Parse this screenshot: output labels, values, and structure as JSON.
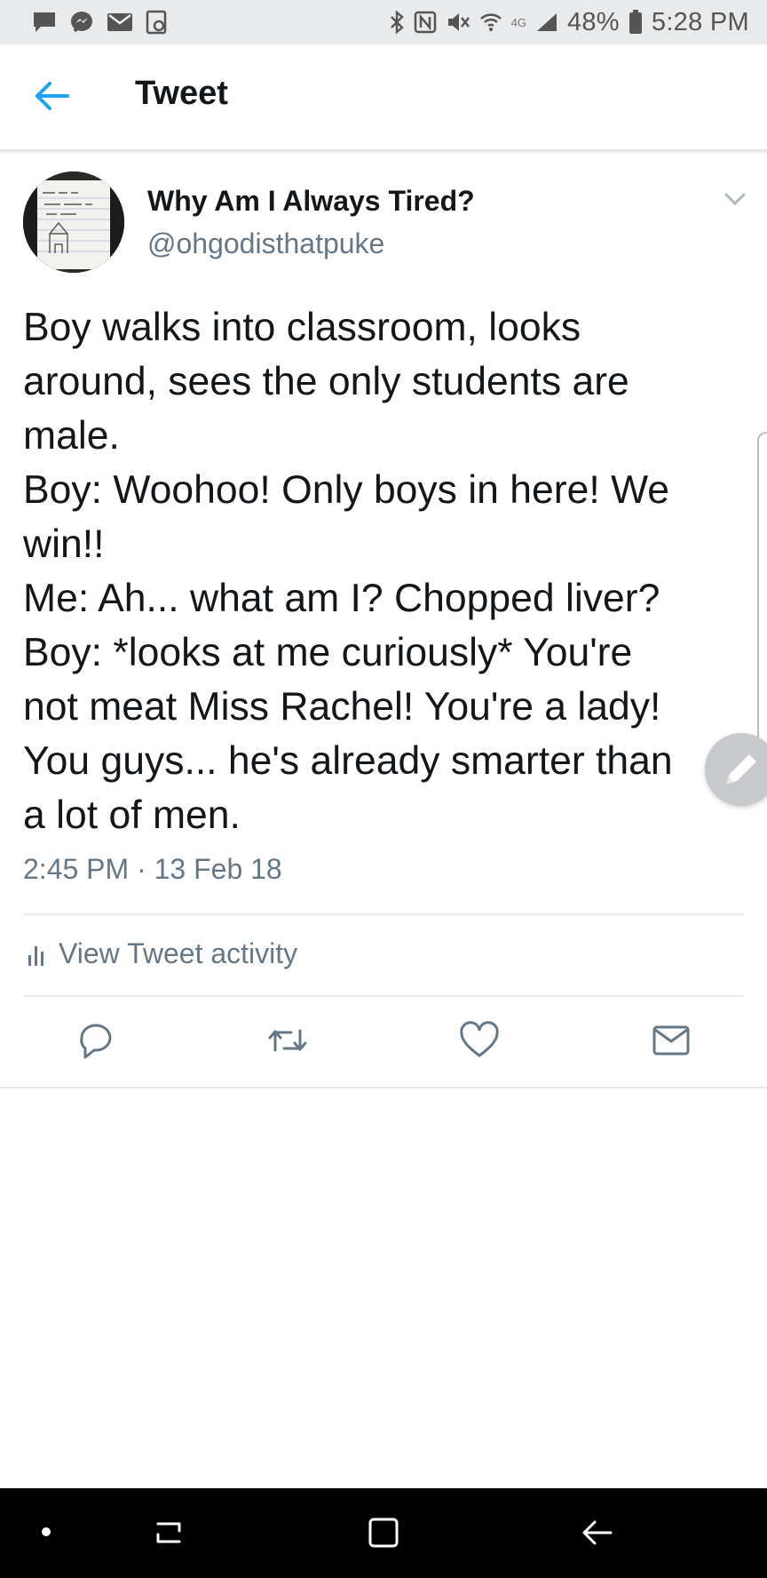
{
  "status_bar": {
    "battery_percent": "48%",
    "time": "5:28 PM",
    "network": "4G",
    "icons_left": [
      "message-icon",
      "messenger-icon",
      "mail-icon",
      "screenshot-icon"
    ],
    "icons_right": [
      "bluetooth-icon",
      "nfc-icon",
      "mute-icon",
      "wifi-icon",
      "signal-icon",
      "battery-icon"
    ]
  },
  "header": {
    "back_icon": "arrow-left-icon",
    "title": "Tweet"
  },
  "tweet": {
    "author_name": "Why Am I Always Tired?",
    "author_handle": "@ohgodisthatpuke",
    "text_lines": [
      "Boy walks into classroom, looks",
      "around, sees the only students are",
      "male.",
      "Boy: Woohoo! Only boys in here! We",
      "win!!",
      "Me: Ah... what am I? Chopped liver?",
      "Boy: *looks at me curiously* You're",
      "not meat Miss Rachel! You're a lady!",
      "You guys... he's already smarter than",
      "a lot of men."
    ],
    "timestamp": "2:45 PM · 13 Feb 18",
    "activity_label": "View Tweet activity"
  },
  "actions": [
    "reply-icon",
    "retweet-icon",
    "like-icon",
    "share-dm-icon"
  ],
  "colors": {
    "accent": "#1da1f2",
    "text_primary": "#14171a",
    "text_secondary": "#657786",
    "status_bar_bg": "#e9eaec",
    "nav_bar_bg": "#000000"
  }
}
